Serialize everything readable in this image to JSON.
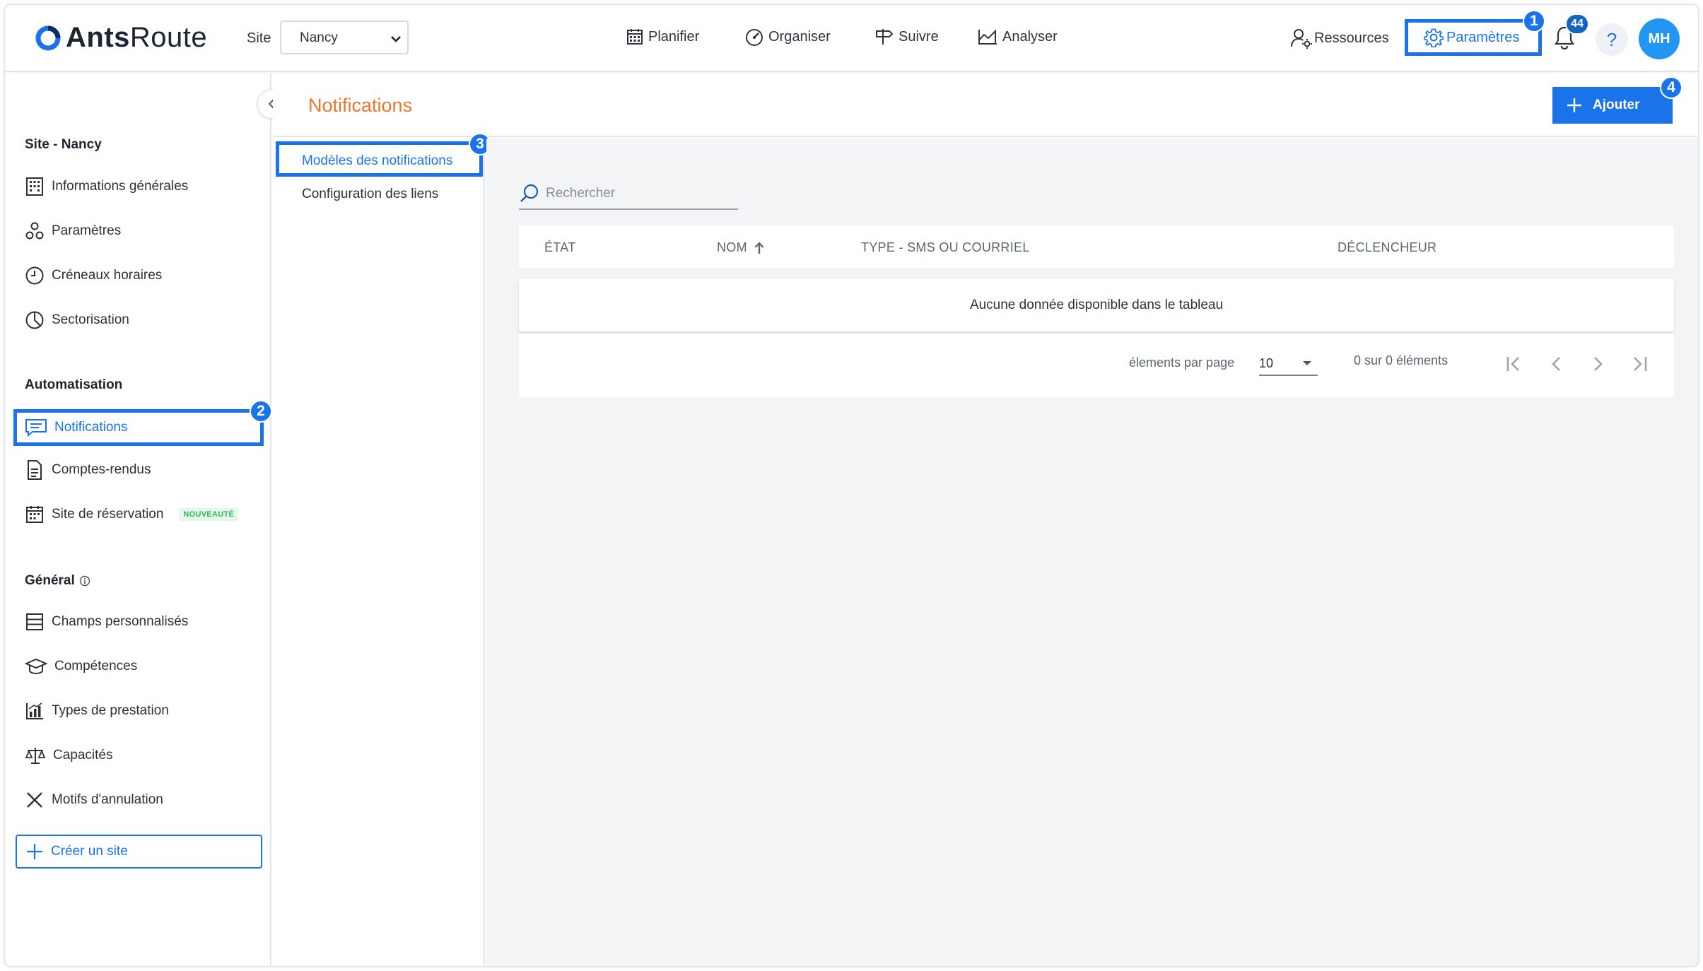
{
  "brand": {
    "name_bold": "Ants",
    "name_light": "Route",
    "accent": "#1a73e8"
  },
  "topbar": {
    "site_label": "Site",
    "site_value": "Nancy",
    "nav": [
      {
        "label": "Planifier",
        "icon": "calendar-icon"
      },
      {
        "label": "Organiser",
        "icon": "gauge-icon"
      },
      {
        "label": "Suivre",
        "icon": "signpost-icon"
      },
      {
        "label": "Analyser",
        "icon": "chart-area-icon"
      }
    ],
    "resources_label": "Ressources",
    "settings_label": "Paramètres",
    "notifications_count": "44",
    "help_label": "?",
    "avatar_initials": "MH"
  },
  "steps": [
    "1",
    "2",
    "3",
    "4"
  ],
  "sidebar": {
    "site_section": "Site - Nancy",
    "site_items": [
      {
        "label": "Informations générales",
        "icon": "building-icon"
      },
      {
        "label": "Paramètres",
        "icon": "cluster-icon"
      },
      {
        "label": "Créneaux horaires",
        "icon": "clock-icon"
      },
      {
        "label": "Sectorisation",
        "icon": "pie-icon"
      }
    ],
    "automation_section": "Automatisation",
    "automation_items": [
      {
        "label": "Notifications",
        "icon": "message-icon"
      },
      {
        "label": "Comptes-rendus",
        "icon": "document-icon"
      },
      {
        "label": "Site de réservation",
        "icon": "calendar-grid-icon"
      }
    ],
    "new_badge": "NOUVEAUTÉ",
    "general_section": "Général",
    "general_items": [
      {
        "label": "Champs personnalisés",
        "icon": "fields-icon"
      },
      {
        "label": "Compétences",
        "icon": "graduation-cap-icon"
      },
      {
        "label": "Types de prestation",
        "icon": "bar-chart-icon"
      },
      {
        "label": "Capacités",
        "icon": "scale-icon"
      },
      {
        "label": "Motifs d'annulation",
        "icon": "x-icon"
      }
    ],
    "create_site_label": "Créer un site"
  },
  "page": {
    "title": "Notifications",
    "add_label": "Ajouter",
    "tabs": [
      "Modèles des notifications",
      "Configuration des liens"
    ]
  },
  "table": {
    "search_placeholder": "Rechercher",
    "columns": [
      "ÉTAT",
      "NOM",
      "TYPE - SMS OU COURRIEL",
      "DÉCLENCHEUR"
    ],
    "sorted_column": "NOM",
    "empty_message": "Aucune donnée disponible dans le tableau",
    "page_size_label": "élements par page",
    "page_size_value": "10",
    "count_text": "0 sur 0 éléments"
  }
}
